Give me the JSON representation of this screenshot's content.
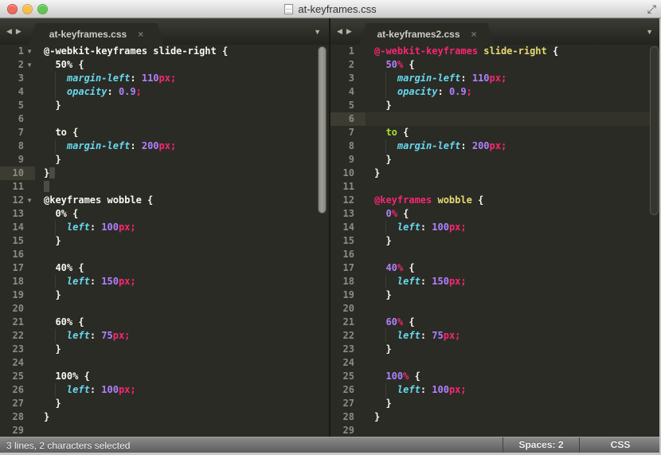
{
  "window": {
    "title": "at-keyframes.css"
  },
  "icons": {
    "back": "◀",
    "forward": "▶",
    "tab_menu": "▼",
    "close_tab": "×",
    "fullscreen": "⤢",
    "fold": "▼"
  },
  "colors": {
    "editor_bg": "#2b2b25",
    "foreground": "#f8f8f2",
    "pink": "#f92672",
    "purple": "#ae81ff",
    "cyan": "#66d9ef",
    "yellow": "#e6db74",
    "green": "#a6e22e",
    "line_number": "#8c8c83",
    "selection": "#4d4c43",
    "line_highlight": "#32322a"
  },
  "statusbar": {
    "left": "3 lines, 2 characters selected",
    "spaces": "Spaces: 2",
    "syntax": "CSS"
  },
  "panes": [
    {
      "tab": {
        "label": "at-keyframes.css"
      },
      "lines": [
        {
          "n": 1,
          "f": true,
          "t": [
            [
              "w",
              "@-webkit-keyframes slide-right {"
            ]
          ]
        },
        {
          "n": 2,
          "f": true,
          "t": [
            [
              "w",
              "  50% {"
            ]
          ]
        },
        {
          "n": 3,
          "t": [
            [
              "w",
              "    "
            ],
            [
              "c",
              "margin-left"
            ],
            [
              "w",
              ": "
            ],
            [
              "u",
              "110"
            ],
            [
              "p",
              "px;"
            ]
          ]
        },
        {
          "n": 4,
          "t": [
            [
              "w",
              "    "
            ],
            [
              "c",
              "opacity"
            ],
            [
              "w",
              ": "
            ],
            [
              "u",
              "0.9"
            ],
            [
              "p",
              ";"
            ]
          ]
        },
        {
          "n": 5,
          "t": [
            [
              "w",
              "  }"
            ]
          ]
        },
        {
          "n": 6,
          "t": []
        },
        {
          "n": 7,
          "t": [
            [
              "w",
              "  to {"
            ]
          ]
        },
        {
          "n": 8,
          "t": [
            [
              "w",
              "    "
            ],
            [
              "c",
              "margin-left"
            ],
            [
              "w",
              ": "
            ],
            [
              "u",
              "200"
            ],
            [
              "p",
              "px;"
            ]
          ]
        },
        {
          "n": 9,
          "t": [
            [
              "w",
              "  }"
            ]
          ]
        },
        {
          "n": 10,
          "h": "g",
          "t": [
            [
              "w",
              "}"
            ],
            [
              "sel",
              " "
            ]
          ]
        },
        {
          "n": 11,
          "t": [
            [
              "sel",
              " "
            ]
          ]
        },
        {
          "n": 12,
          "f": true,
          "t": [
            [
              "w",
              "@keyframes wobble {"
            ]
          ]
        },
        {
          "n": 13,
          "t": [
            [
              "w",
              "  0% {"
            ]
          ]
        },
        {
          "n": 14,
          "t": [
            [
              "w",
              "    "
            ],
            [
              "c",
              "left"
            ],
            [
              "w",
              ": "
            ],
            [
              "u",
              "100"
            ],
            [
              "p",
              "px;"
            ]
          ]
        },
        {
          "n": 15,
          "t": [
            [
              "w",
              "  }"
            ]
          ]
        },
        {
          "n": 16,
          "t": []
        },
        {
          "n": 17,
          "t": [
            [
              "w",
              "  40% {"
            ]
          ]
        },
        {
          "n": 18,
          "t": [
            [
              "w",
              "    "
            ],
            [
              "c",
              "left"
            ],
            [
              "w",
              ": "
            ],
            [
              "u",
              "150"
            ],
            [
              "p",
              "px;"
            ]
          ]
        },
        {
          "n": 19,
          "t": [
            [
              "w",
              "  }"
            ]
          ]
        },
        {
          "n": 20,
          "t": []
        },
        {
          "n": 21,
          "t": [
            [
              "w",
              "  60% {"
            ]
          ]
        },
        {
          "n": 22,
          "t": [
            [
              "w",
              "    "
            ],
            [
              "c",
              "left"
            ],
            [
              "w",
              ": "
            ],
            [
              "u",
              "75"
            ],
            [
              "p",
              "px;"
            ]
          ]
        },
        {
          "n": 23,
          "t": [
            [
              "w",
              "  }"
            ]
          ]
        },
        {
          "n": 24,
          "t": []
        },
        {
          "n": 25,
          "t": [
            [
              "w",
              "  100% {"
            ]
          ]
        },
        {
          "n": 26,
          "t": [
            [
              "w",
              "    "
            ],
            [
              "c",
              "left"
            ],
            [
              "w",
              ": "
            ],
            [
              "u",
              "100"
            ],
            [
              "p",
              "px;"
            ]
          ]
        },
        {
          "n": 27,
          "t": [
            [
              "w",
              "  }"
            ]
          ]
        },
        {
          "n": 28,
          "t": [
            [
              "w",
              "}"
            ]
          ]
        },
        {
          "n": 29,
          "t": []
        }
      ]
    },
    {
      "tab": {
        "label": "at-keyframes2.css"
      },
      "lines": [
        {
          "n": 1,
          "t": [
            [
              "p",
              "@-webkit-keyframes"
            ],
            [
              "w",
              " "
            ],
            [
              "y",
              "slide-right"
            ],
            [
              "w",
              " {"
            ]
          ]
        },
        {
          "n": 2,
          "t": [
            [
              "w",
              "  "
            ],
            [
              "u",
              "50"
            ],
            [
              "p",
              "%"
            ],
            [
              "w",
              " {"
            ]
          ]
        },
        {
          "n": 3,
          "t": [
            [
              "w",
              "    "
            ],
            [
              "c",
              "margin-left"
            ],
            [
              "w",
              ": "
            ],
            [
              "u",
              "110"
            ],
            [
              "p",
              "px;"
            ]
          ]
        },
        {
          "n": 4,
          "t": [
            [
              "w",
              "    "
            ],
            [
              "c",
              "opacity"
            ],
            [
              "w",
              ": "
            ],
            [
              "u",
              "0.9"
            ],
            [
              "p",
              ";"
            ]
          ]
        },
        {
          "n": 5,
          "t": [
            [
              "w",
              "  }"
            ]
          ]
        },
        {
          "n": 6,
          "h": "l",
          "t": []
        },
        {
          "n": 7,
          "t": [
            [
              "w",
              "  "
            ],
            [
              "g",
              "to"
            ],
            [
              "w",
              " {"
            ]
          ]
        },
        {
          "n": 8,
          "t": [
            [
              "w",
              "    "
            ],
            [
              "c",
              "margin-left"
            ],
            [
              "w",
              ": "
            ],
            [
              "u",
              "200"
            ],
            [
              "p",
              "px;"
            ]
          ]
        },
        {
          "n": 9,
          "t": [
            [
              "w",
              "  }"
            ]
          ]
        },
        {
          "n": 10,
          "t": [
            [
              "w",
              "}"
            ]
          ]
        },
        {
          "n": 11,
          "t": []
        },
        {
          "n": 12,
          "t": [
            [
              "p",
              "@keyframes"
            ],
            [
              "w",
              " "
            ],
            [
              "y",
              "wobble"
            ],
            [
              "w",
              " {"
            ]
          ]
        },
        {
          "n": 13,
          "t": [
            [
              "w",
              "  "
            ],
            [
              "u",
              "0"
            ],
            [
              "p",
              "%"
            ],
            [
              "w",
              " {"
            ]
          ]
        },
        {
          "n": 14,
          "t": [
            [
              "w",
              "    "
            ],
            [
              "c",
              "left"
            ],
            [
              "w",
              ": "
            ],
            [
              "u",
              "100"
            ],
            [
              "p",
              "px;"
            ]
          ]
        },
        {
          "n": 15,
          "t": [
            [
              "w",
              "  }"
            ]
          ]
        },
        {
          "n": 16,
          "t": []
        },
        {
          "n": 17,
          "t": [
            [
              "w",
              "  "
            ],
            [
              "u",
              "40"
            ],
            [
              "p",
              "%"
            ],
            [
              "w",
              " {"
            ]
          ]
        },
        {
          "n": 18,
          "t": [
            [
              "w",
              "    "
            ],
            [
              "c",
              "left"
            ],
            [
              "w",
              ": "
            ],
            [
              "u",
              "150"
            ],
            [
              "p",
              "px;"
            ]
          ]
        },
        {
          "n": 19,
          "t": [
            [
              "w",
              "  }"
            ]
          ]
        },
        {
          "n": 20,
          "t": []
        },
        {
          "n": 21,
          "t": [
            [
              "w",
              "  "
            ],
            [
              "u",
              "60"
            ],
            [
              "p",
              "%"
            ],
            [
              "w",
              " {"
            ]
          ]
        },
        {
          "n": 22,
          "t": [
            [
              "w",
              "    "
            ],
            [
              "c",
              "left"
            ],
            [
              "w",
              ": "
            ],
            [
              "u",
              "75"
            ],
            [
              "p",
              "px;"
            ]
          ]
        },
        {
          "n": 23,
          "t": [
            [
              "w",
              "  }"
            ]
          ]
        },
        {
          "n": 24,
          "t": []
        },
        {
          "n": 25,
          "t": [
            [
              "w",
              "  "
            ],
            [
              "u",
              "100"
            ],
            [
              "p",
              "%"
            ],
            [
              "w",
              " {"
            ]
          ]
        },
        {
          "n": 26,
          "t": [
            [
              "w",
              "    "
            ],
            [
              "c",
              "left"
            ],
            [
              "w",
              ": "
            ],
            [
              "u",
              "100"
            ],
            [
              "p",
              "px;"
            ]
          ]
        },
        {
          "n": 27,
          "t": [
            [
              "w",
              "  }"
            ]
          ]
        },
        {
          "n": 28,
          "t": [
            [
              "w",
              "}"
            ]
          ]
        },
        {
          "n": 29,
          "t": []
        }
      ]
    }
  ]
}
